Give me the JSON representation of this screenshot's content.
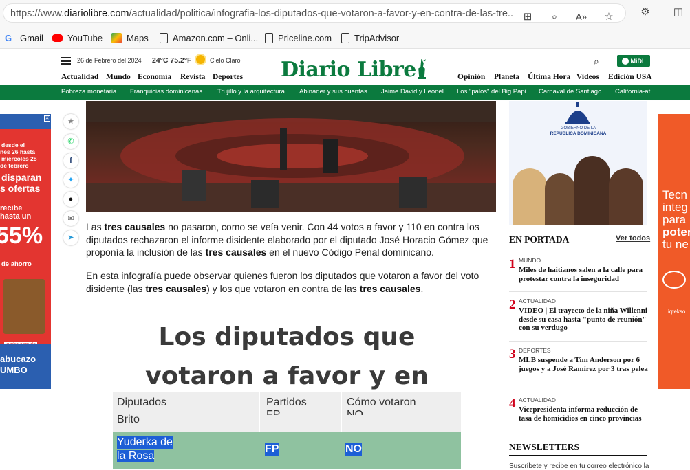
{
  "browser": {
    "url_prefix": "https://www.",
    "url_domain": "diariolibre.com",
    "url_path": "/actualidad/politica/infografia-los-diputados-que-votaron-a-favor-y-en-contra-de-las-tre...",
    "bookmarks": [
      "Gmail",
      "YouTube",
      "Maps",
      "Amazon.com – Onli...",
      "Priceline.com",
      "TripAdvisor"
    ]
  },
  "header": {
    "date": "26 de Febrero del 2024",
    "weather": "24°C 75.2°F",
    "sky": "Cielo Claro",
    "logo": "Diario Libre",
    "account_label": "MiDL",
    "nav_left": [
      "Actualidad",
      "Mundo",
      "Economía",
      "Revista",
      "Deportes"
    ],
    "nav_right": [
      "Opinión",
      "Planeta",
      "Última Hora",
      "Videos",
      "Edición USA"
    ],
    "topics": [
      "Pobreza monetaria",
      "Franquicias dominicanas",
      "Trujillo y la arquitectura",
      "Abinader y sus cuentas",
      "Jaime David y Leonel",
      "Los \"palos\" del Big Papi",
      "Carnaval de Santiago",
      "California-at"
    ]
  },
  "article": {
    "p1_a": "Las ",
    "p1_b": "tres causales",
    "p1_c": " no pasaron, como se veía venir. Con 44 votos a favor y 110 en contra los diputados rechazaron el informe disidente elaborado por el diputado José Horacio Gómez que proponía la inclusión de las ",
    "p1_d": "tres causales",
    "p1_e": " en el nuevo Código Penal dominicano.",
    "p2_a": "En esta infografía puede observar quienes fueron los diputados que votaron a favor del voto disidente (las ",
    "p2_b": "tres causales",
    "p2_c": ") y los que votaron en contra de las ",
    "p2_d": "tres causales",
    "p2_e": ".",
    "infographic_title": "Los diputados que votaron a favor y en contra del aborto",
    "table_headers": [
      "Diputados",
      "Partidos",
      "Cómo votaron"
    ],
    "row_prev_name": "Brito",
    "row_prev_party": "FP",
    "row_prev_vote": "NO",
    "row_hl_name_1": "Yuderka de",
    "row_hl_name_2": "la Rosa",
    "row_hl_party": "FP",
    "row_hl_vote": "NO"
  },
  "ads": {
    "left_lines": [
      "desde el",
      "nes 26 hasta",
      "miércoles 28",
      "de febrero",
      "disparan",
      "s ofertas",
      "recibe",
      "hasta un",
      "55%",
      "de ahorro",
      "jumbo.com.do",
      "abucazo",
      "UMBO"
    ],
    "right_lines": [
      "Tecn",
      "integ",
      "para",
      "poter",
      "tu ne",
      "iqtekso"
    ],
    "gov_line_1": "GOBIERNO DE LA",
    "gov_line_2": "REPÚBLICA DOMINICANA"
  },
  "sidebar": {
    "section_title": "EN PORTADA",
    "see_all": "Ver todos",
    "stories": [
      {
        "num": "1",
        "cat": "MUNDO",
        "head": "Miles de haitianos salen a la calle para protestar contra la inseguridad"
      },
      {
        "num": "2",
        "cat": "ACTUALIDAD",
        "head": "VIDEO | El trayecto de la niña Willenni desde su casa hasta \"punto de reunión\" con su verdugo"
      },
      {
        "num": "3",
        "cat": "DEPORTES",
        "head": "MLB suspende a Tim Anderson por 6 juegos y a José Ramírez por 3 tras pelea"
      },
      {
        "num": "4",
        "cat": "ACTUALIDAD",
        "head": "Vicepresidenta informa reducción de tasa de homicidios en cinco provincias"
      }
    ],
    "newsletters_title": "NEWSLETTERS",
    "newsletters_sub": "Suscríbete y recibe en tu correo electrónico la"
  }
}
